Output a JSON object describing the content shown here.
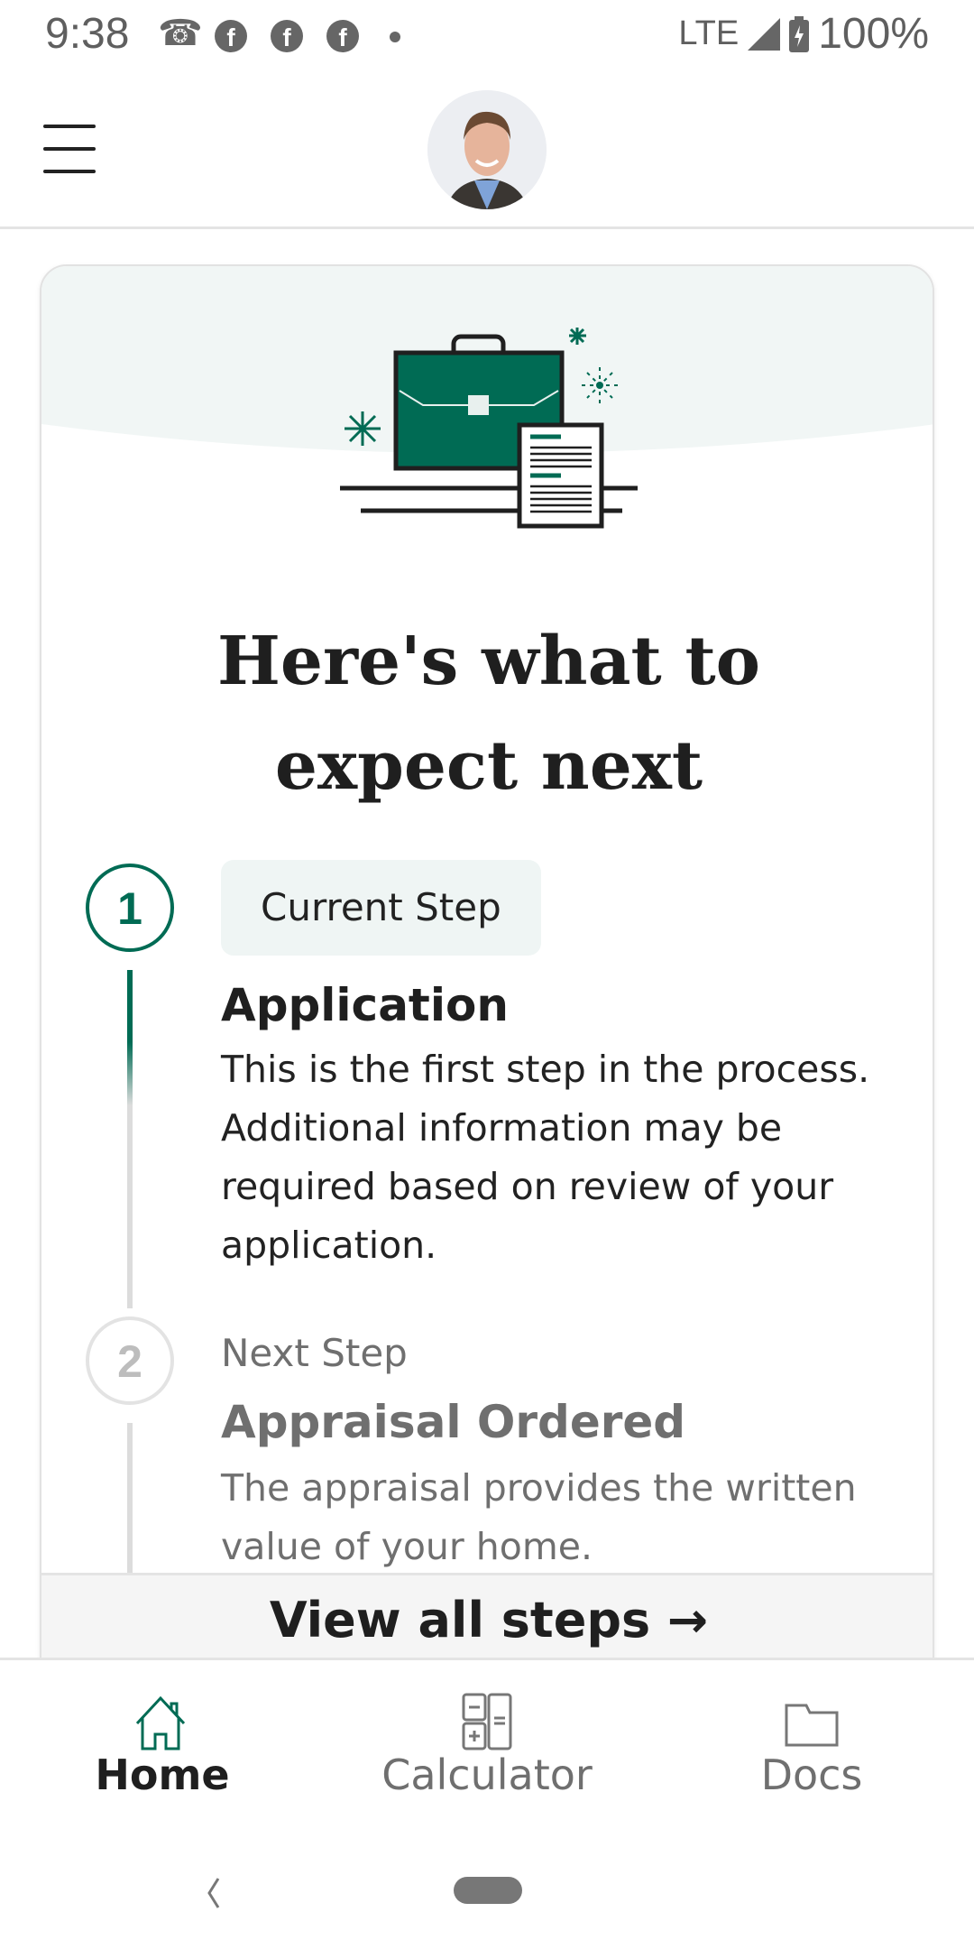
{
  "status_bar": {
    "time": "9:38",
    "network": "LTE",
    "battery": "100%"
  },
  "header": {
    "menu_icon": "hamburger-icon",
    "avatar": "loan-officer-photo"
  },
  "card": {
    "title": "Here's what to expect next",
    "steps": [
      {
        "number": "1",
        "label": "Current Step",
        "title": "Application",
        "description": "This is the first step in the process. Additional information may be required based on review of your application.",
        "state": "current"
      },
      {
        "number": "2",
        "label": "Next Step",
        "title": "Appraisal Ordered",
        "description": "The appraisal provides the written value of your home.",
        "state": "upcoming"
      }
    ],
    "view_all": "View all steps →"
  },
  "bottom_nav": {
    "items": [
      {
        "label": "Home",
        "icon": "home-icon",
        "active": true
      },
      {
        "label": "Calculator",
        "icon": "calculator-icon"
      },
      {
        "label": "Docs",
        "icon": "folder-icon"
      }
    ]
  },
  "colors": {
    "accent": "#006b54",
    "band": "#f1f6f5"
  }
}
